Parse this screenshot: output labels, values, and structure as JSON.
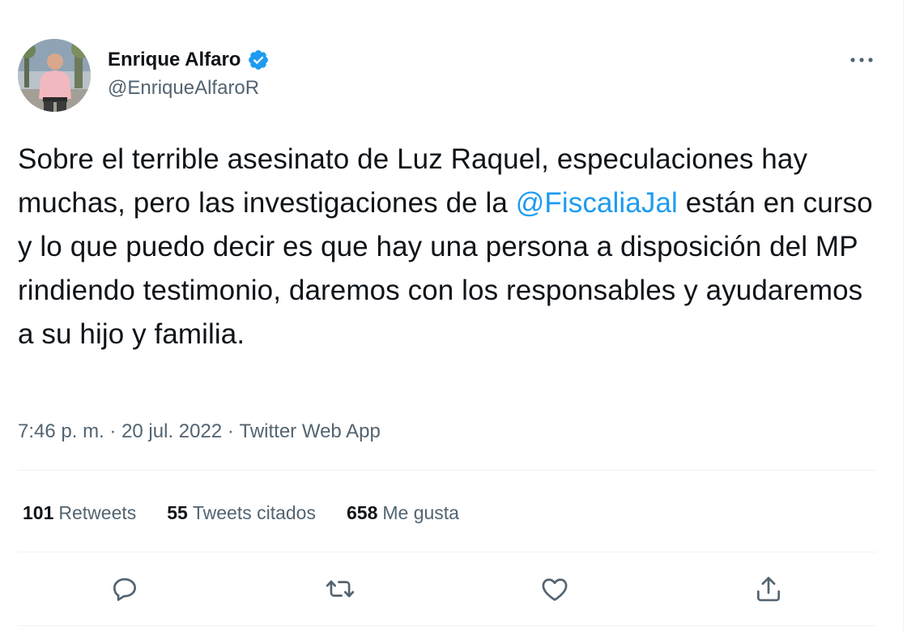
{
  "author": {
    "display_name": "Enrique Alfaro",
    "handle": "@EnriqueAlfaroR",
    "verified_icon": "verified-badge-icon",
    "avatar": "profile-photo"
  },
  "tweet": {
    "text_before": "Sobre el terrible asesinato de Luz Raquel, especulaciones hay muchas, pero las investigaciones de la ",
    "mention": "@FiscaliaJal",
    "text_after": " están en curso y lo que puedo decir es que hay una persona a disposición del MP rindiendo testimonio, daremos con los responsables y ayudaremos a su hijo y familia."
  },
  "meta": {
    "time": "7:46 p. m.",
    "separator1": " · ",
    "date": "20 jul. 2022",
    "separator2": " · ",
    "source": "Twitter Web App"
  },
  "stats": {
    "retweets": {
      "count": "101",
      "label": "Retweets"
    },
    "quotes": {
      "count": "55",
      "label": "Tweets citados"
    },
    "likes": {
      "count": "658",
      "label": "Me gusta"
    }
  },
  "actions": {
    "reply_icon": "reply-icon",
    "retweet_icon": "retweet-icon",
    "like_icon": "like-heart-icon",
    "share_icon": "share-icon",
    "more_icon": "more-dots-icon"
  },
  "colors": {
    "accent": "#1d9bf0",
    "secondary_text": "#536471",
    "primary_text": "#0f1419",
    "divider": "#eff3f4"
  }
}
